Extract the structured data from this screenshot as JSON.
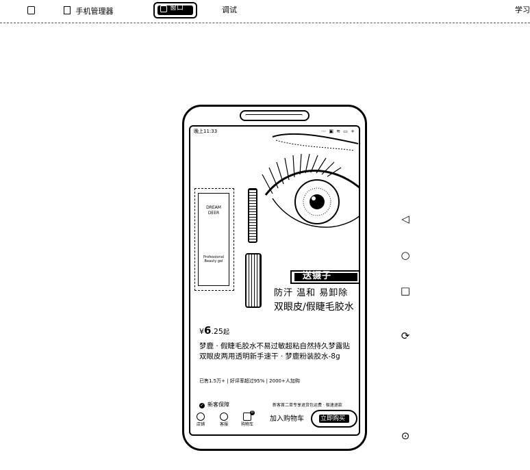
{
  "toolbar": {
    "menu_label": "(=)",
    "device_manager": "手机管理器",
    "active_tool": "窗口",
    "debug": "调试",
    "learn": "学习"
  },
  "statusbar": {
    "time": "晚上11:33",
    "icons": "⋯ ▣ ≋ ▭ +"
  },
  "product": {
    "brand_line1": "DREAM",
    "brand_line2": "DEER",
    "box_small_text": "Professional Beauty gel",
    "tag": "送镊子",
    "features": "防汗  温和  易卸除",
    "subtitle": "双眼皮/假睫毛胶水",
    "price_symbol": "¥",
    "price_int": "6",
    "price_dec": ".25",
    "price_unit": "起",
    "title": "梦鹿 · 假睫毛胶水不易过敏超粘自然持久梦露贴双眼皮两用透明新手速干 · 梦鹿粉装胶水-8g",
    "stats": "已售1.5万+  |  好评率超过95%  |  2000+人加购"
  },
  "assurance": {
    "label": "新客保障",
    "promo": "新客首二单专享退货包运费 · 极速退款"
  },
  "bottom_bar": {
    "shop": "店铺",
    "service": "客服",
    "cart": "购物车",
    "cart_count": "0",
    "add_to_cart": "加入购物车",
    "buy_now": "立即购买"
  },
  "side_controls": {
    "back": "◁",
    "home": "○",
    "recent": "□",
    "rotate": "⟳",
    "locate": "⊙"
  },
  "colors": {
    "foreground": "#000000",
    "background": "#ffffff"
  }
}
